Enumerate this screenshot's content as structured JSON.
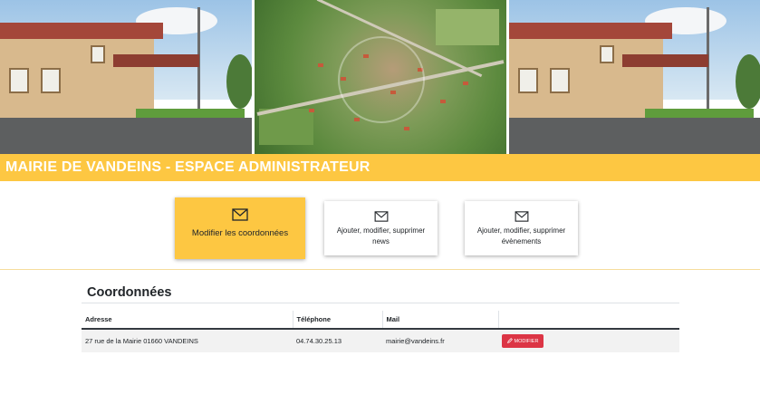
{
  "header": {
    "title": "MAIRIE DE VANDEINS - ESPACE ADMINISTRATEUR"
  },
  "actions": [
    {
      "label": "Modifier les coordonnées",
      "icon": "envelope-icon",
      "active": true
    },
    {
      "label": "Ajouter, modifier, supprimer news",
      "icon": "envelope-icon",
      "active": false
    },
    {
      "label": "Ajouter, modifier, supprimer évènements",
      "icon": "envelope-icon",
      "active": false
    }
  ],
  "section": {
    "title": "Coordonnées"
  },
  "table": {
    "headers": [
      "Adresse",
      "Téléphone",
      "Mail",
      ""
    ],
    "rows": [
      {
        "address": "27 rue de la Mairie 01660 VANDEINS",
        "phone": "04.74.30.25.13",
        "mail": "mairie@vandeins.fr",
        "action": "MODIFIER"
      }
    ]
  },
  "colors": {
    "accent": "#fdc742",
    "danger": "#dc3545"
  }
}
